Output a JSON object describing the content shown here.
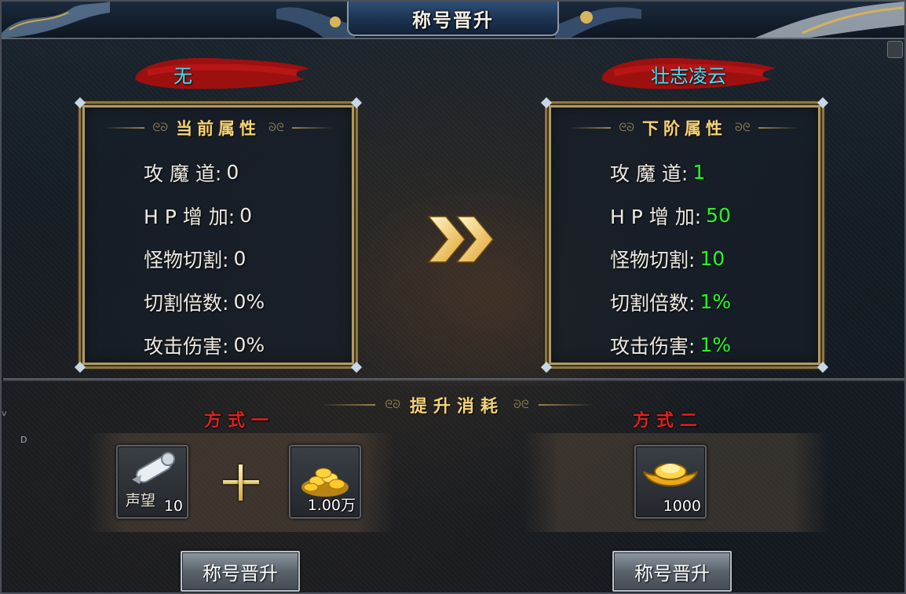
{
  "window": {
    "title": "称号晋升"
  },
  "current": {
    "rank_name": "无",
    "panel_title": "当前属性",
    "attributes": [
      {
        "label": "攻 魔 道:",
        "value": "0"
      },
      {
        "label": "H P 增 加:",
        "value": "0"
      },
      {
        "label": "怪物切割:",
        "value": "0"
      },
      {
        "label": "切割倍数:",
        "value": "0%"
      },
      {
        "label": "攻击伤害:",
        "value": "0%"
      }
    ]
  },
  "next": {
    "rank_name": "壮志凌云",
    "panel_title": "下阶属性",
    "attributes": [
      {
        "label": "攻 魔 道:",
        "value": "1"
      },
      {
        "label": "H P 增 加:",
        "value": "50"
      },
      {
        "label": "怪物切割:",
        "value": "10"
      },
      {
        "label": "切割倍数:",
        "value": "1%"
      },
      {
        "label": "攻击伤害:",
        "value": "1%"
      }
    ]
  },
  "cost": {
    "title": "提升消耗",
    "method_one": {
      "label": "方式一",
      "item1": {
        "name": "声望",
        "icon": "scroll-icon",
        "qty": "10"
      },
      "item2": {
        "icon": "gold-coins-icon",
        "qty": "1.00万"
      },
      "button": "称号晋升"
    },
    "method_two": {
      "label": "方式二",
      "item1": {
        "icon": "gold-ingot-icon",
        "qty": "1000"
      },
      "button": "称号晋升"
    }
  },
  "side": {
    "glyph_a": "D",
    "glyph_b": "v"
  },
  "colors": {
    "rank_text": "#37e6ff",
    "gain_value": "#22ff22",
    "panel_title": "#f3d27a",
    "method_label": "#e0201e"
  }
}
